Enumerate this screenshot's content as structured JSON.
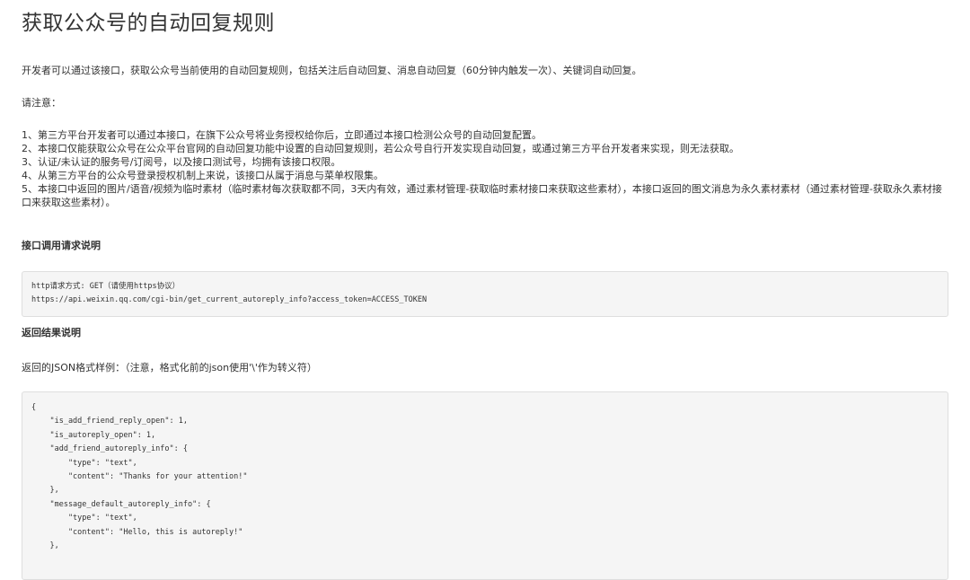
{
  "title": "获取公众号的自动回复规则",
  "intro": "开发者可以通过该接口，获取公众号当前使用的自动回复规则，包括关注后自动回复、消息自动回复（60分钟内触发一次）、关键词自动回复。",
  "note_label": "请注意：",
  "notes": [
    "1、第三方平台开发者可以通过本接口，在旗下公众号将业务授权给你后，立即通过本接口检测公众号的自动回复配置。",
    "2、本接口仅能获取公众号在公众平台官网的自动回复功能中设置的自动回复规则，若公众号自行开发实现自动回复，或通过第三方平台开发者来实现，则无法获取。",
    "3、认证/未认证的服务号/订阅号，以及接口测试号，均拥有该接口权限。",
    "4、从第三方平台的公众号登录授权机制上来说，该接口从属于消息与菜单权限集。",
    "5、本接口中返回的图片/语音/视频为临时素材（临时素材每次获取都不同，3天内有效，通过素材管理-获取临时素材接口来获取这些素材），本接口返回的图文消息为永久素材素材（通过素材管理-获取永久素材接口来获取这些素材）。"
  ],
  "request_heading": "接口调用请求说明",
  "request_code": [
    "http请求方式: GET（请使用https协议）",
    "https://api.weixin.qq.com/cgi-bin/get_current_autoreply_info?access_token=ACCESS_TOKEN"
  ],
  "result_heading": "返回结果说明",
  "json_intro": "返回的JSON格式样例：（注意，格式化前的json使用'\\'作为转义符）",
  "json_code": [
    "{",
    "    \"is_add_friend_reply_open\": 1,",
    "    \"is_autoreply_open\": 1,",
    "    \"add_friend_autoreply_info\": {",
    "        \"type\": \"text\",",
    "        \"content\": \"Thanks for your attention!\"",
    "    },",
    "    \"message_default_autoreply_info\": {",
    "        \"type\": \"text\",",
    "        \"content\": \"Hello, this is autoreply!\"",
    "    },"
  ]
}
